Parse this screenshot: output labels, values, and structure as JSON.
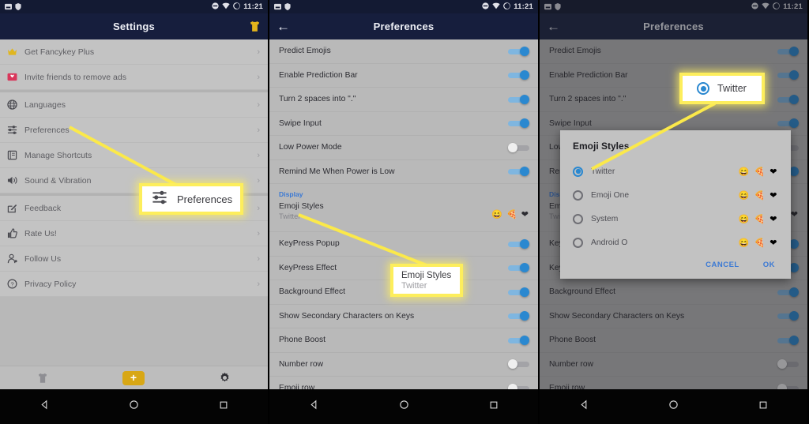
{
  "status_bar": {
    "time": "11:21",
    "icons_left": [
      "sim-icon",
      "shield-icon"
    ],
    "icons_right": [
      "dnd-icon",
      "wifi-icon",
      "moon-icon"
    ]
  },
  "panel_left": {
    "title": "Settings",
    "theme_icon": "tshirt-icon",
    "groups": [
      {
        "items": [
          {
            "label": "Get Fancykey Plus",
            "icon": "crown-icon"
          },
          {
            "label": "Invite friends to remove ads",
            "icon": "gift-envelope-icon"
          }
        ]
      },
      {
        "items": [
          {
            "label": "Languages",
            "icon": "globe-icon"
          },
          {
            "label": "Preferences",
            "icon": "sliders-icon"
          },
          {
            "label": "Manage Shortcuts",
            "icon": "book-icon"
          },
          {
            "label": "Sound & Vibration",
            "icon": "speaker-icon"
          }
        ]
      },
      {
        "items": [
          {
            "label": "Feedback",
            "icon": "edit-square-icon"
          },
          {
            "label": "Rate Us!",
            "icon": "thumbs-up-icon"
          },
          {
            "label": "Follow Us",
            "icon": "person-add-icon"
          },
          {
            "label": "Privacy Policy",
            "icon": "question-circle-icon"
          }
        ]
      }
    ],
    "tabbar": {
      "left_icon": "tshirt-icon",
      "center_label": "+",
      "right_icon": "gear-icon"
    }
  },
  "panel_mid": {
    "title": "Preferences",
    "back_icon": "back-arrow-icon",
    "rows": [
      {
        "label": "Predict Emojis",
        "toggle": "on"
      },
      {
        "label": "Enable Prediction Bar",
        "toggle": "on"
      },
      {
        "label": "Turn 2 spaces into \".\"",
        "toggle": "on"
      },
      {
        "label": "Swipe Input",
        "toggle": "on"
      },
      {
        "label": "Low Power Mode",
        "toggle": "off"
      },
      {
        "label": "Remind Me When Power is Low",
        "toggle": "on"
      }
    ],
    "section_header": "Display",
    "emoji_row": {
      "label": "Emoji Styles",
      "value": "Twitter",
      "preview": "😄 🍕 ❤"
    },
    "rows2": [
      {
        "label": "KeyPress Popup",
        "toggle": "on"
      },
      {
        "label": "KeyPress Effect",
        "toggle": "on"
      },
      {
        "label": "Background Effect",
        "toggle": "on"
      },
      {
        "label": "Show Secondary Characters on Keys",
        "toggle": "on"
      },
      {
        "label": "Phone Boost",
        "toggle": "on"
      },
      {
        "label": "Number row",
        "toggle": "off"
      },
      {
        "label": "Emoji row",
        "toggle": "off"
      }
    ]
  },
  "panel_right": {
    "title": "Preferences",
    "back_icon": "back-arrow-icon",
    "dialog": {
      "title": "Emoji Styles",
      "options": [
        {
          "label": "Twitter",
          "selected": true,
          "preview": "😄 🍕 ❤"
        },
        {
          "label": "Emoji One",
          "selected": false,
          "preview": "😄 🍕 ❤"
        },
        {
          "label": "System",
          "selected": false,
          "preview": "😄 🍕 ❤"
        },
        {
          "label": "Android O",
          "selected": false,
          "preview": "😄 🍕 ❤"
        }
      ],
      "cancel_label": "CANCEL",
      "ok_label": "OK"
    }
  },
  "callouts": {
    "preferences": {
      "title": "Preferences",
      "icon": "sliders-icon"
    },
    "emoji_styles": {
      "title": "Emoji Styles",
      "subtitle": "Twitter"
    },
    "twitter": {
      "title": "Twitter",
      "icon": "radio-selected-icon"
    }
  },
  "nav_bar": {
    "back": "triangle-back-icon",
    "home": "circle-home-icon",
    "recents": "square-recents-icon"
  },
  "colors": {
    "header": "#161e3d",
    "accent_blue": "#2a88d0",
    "highlight_yellow": "#fdee5c",
    "gold": "#d8a715"
  }
}
